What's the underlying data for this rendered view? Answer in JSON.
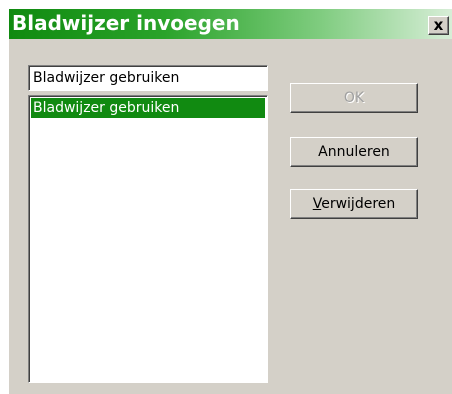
{
  "dialog": {
    "title": "Bladwijzer invoegen",
    "close_label": "x"
  },
  "name_field": {
    "value": "Bladwijzer gebruiken"
  },
  "bookmark_list": {
    "items": [
      {
        "label": "Bladwijzer gebruiken",
        "selected": true
      }
    ]
  },
  "buttons": {
    "ok_label": "OK",
    "ok_enabled": false,
    "cancel_label": "Annuleren",
    "delete_mnemonic": "V",
    "delete_rest": "erwijderen"
  },
  "colors": {
    "accent": "#118a11",
    "dialog_bg": "#d4d0c8",
    "disabled_text": "#a0a0a0"
  }
}
